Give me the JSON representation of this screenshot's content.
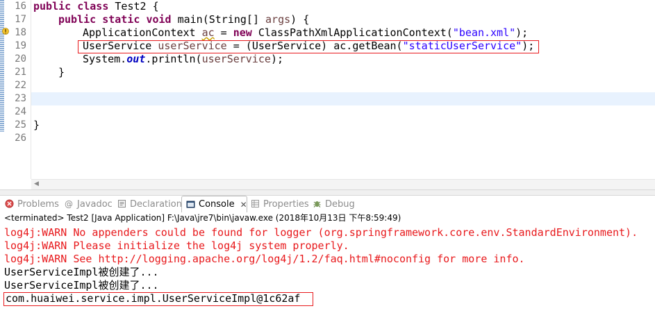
{
  "editor": {
    "line_numbers": [
      "16",
      "17",
      "18",
      "19",
      "20",
      "21",
      "22",
      "23",
      "24",
      "25",
      "26"
    ],
    "lines": {
      "l16": {
        "kw1": "public",
        "kw2": "class",
        "rest": " Test2 {"
      },
      "l17": {
        "kw1": "public",
        "kw2": "static",
        "kw3": "void",
        "name": " main(String[] ",
        "param": "args",
        "rest": ") {"
      },
      "l18": {
        "type": "ApplicationContext ",
        "var": "ac",
        "eq": " = ",
        "kw": "new",
        "ctor": " ClassPathXmlApplicationContext(",
        "str": "\"bean.xml\"",
        "end": ");"
      },
      "l19": {
        "type": "UserService ",
        "var": "userService",
        "cast": " = (UserService) ",
        "call": "ac.getBean(",
        "str": "\"staticUserService\"",
        "end": ");"
      },
      "l20": {
        "pre": "System.",
        "field": "out",
        "mid": ".println(",
        "var": "userService",
        "end": ");"
      },
      "l21": "}",
      "l25": "}"
    }
  },
  "tabs": [
    {
      "label": "Problems",
      "icon": "problems-icon",
      "active": false
    },
    {
      "label": "Javadoc",
      "icon": "javadoc-icon",
      "active": false
    },
    {
      "label": "Declaration",
      "icon": "declaration-icon",
      "active": false
    },
    {
      "label": "Console",
      "icon": "console-icon",
      "active": true,
      "close": "✕"
    },
    {
      "label": "Properties",
      "icon": "properties-icon",
      "active": false
    },
    {
      "label": "Debug",
      "icon": "debug-icon",
      "active": false
    }
  ],
  "console": {
    "header": "<terminated> Test2 [Java Application] F:\\Java\\jre7\\bin\\javaw.exe (2018年10月13日 下午8:59:49)",
    "output": [
      {
        "text": "log4j:WARN No appenders could be found for logger (org.springframework.core.env.StandardEnvironment).",
        "kind": "err"
      },
      {
        "text": "log4j:WARN Please initialize the log4j system properly.",
        "kind": "err"
      },
      {
        "text": "log4j:WARN See http://logging.apache.org/log4j/1.2/faq.html#noconfig for more info.",
        "kind": "err"
      },
      {
        "text": "UserServiceImpl被创建了...",
        "kind": "std"
      },
      {
        "text": "UserServiceImpl被创建了...",
        "kind": "std"
      },
      {
        "text": "com.huaiwei.service.impl.UserServiceImpl@1c62af",
        "kind": "std"
      }
    ]
  },
  "colors": {
    "keyword": "#7f0055",
    "string": "#2a00ff",
    "error": "#e8191c",
    "highlight_box": "#e8191c"
  }
}
